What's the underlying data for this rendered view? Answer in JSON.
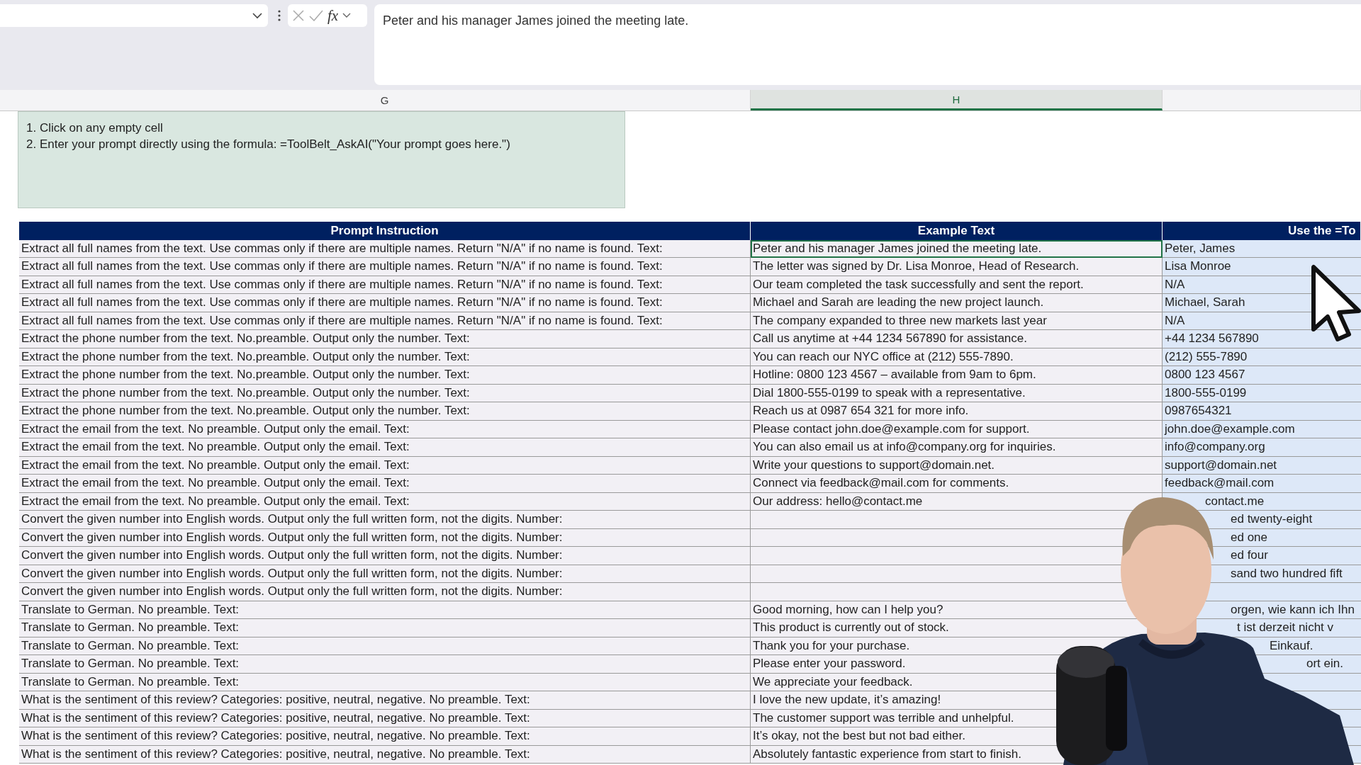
{
  "formula_bar": {
    "function_label": "fx",
    "content": "Peter and his manager James joined the meeting late."
  },
  "column_headers": [
    {
      "label": "G",
      "selected": false
    },
    {
      "label": "H",
      "selected": true
    }
  ],
  "instructions": [
    "1. Click on any empty cell",
    "2. Enter your prompt directly using the formula: =ToolBelt_AskAI(\"Your prompt goes here.\")"
  ],
  "table": {
    "columns": [
      "Prompt Instruction",
      "Example Text",
      "Use the =To"
    ],
    "rows": [
      {
        "prompt": "Extract all full names from the text. Use commas only if there are multiple names. Return \"N/A\" if no name is found. Text:",
        "example": "Peter and his manager James joined the meeting late.",
        "result": "Peter, James",
        "selected": true
      },
      {
        "prompt": "Extract all full names from the text. Use commas only if there are multiple names. Return \"N/A\" if no name is found. Text:",
        "example": "The letter was signed by Dr. Lisa Monroe, Head of Research.",
        "result": "Lisa Monroe",
        "selected": false
      },
      {
        "prompt": "Extract all full names from the text. Use commas only if there are multiple names. Return \"N/A\" if no name is found. Text:",
        "example": "Our team completed the task successfully and sent the report.",
        "result": "N/A",
        "selected": false
      },
      {
        "prompt": "Extract all full names from the text. Use commas only if there are multiple names. Return \"N/A\" if no name is found. Text:",
        "example": "Michael and Sarah are leading the new project launch.",
        "result": "Michael, Sarah",
        "selected": false
      },
      {
        "prompt": "Extract all full names from the text. Use commas only if there are multiple names. Return \"N/A\" if no name is found. Text:",
        "example": "The company expanded to three new markets last year",
        "result": "N/A",
        "selected": false
      },
      {
        "prompt": "Extract the phone number from the text. No.preamble. Output only the number. Text:",
        "example": "Call us anytime at +44 1234 567890 for assistance.",
        "result": "+44 1234 567890",
        "selected": false
      },
      {
        "prompt": "Extract the phone number from the text. No.preamble. Output only the number. Text:",
        "example": "You can reach our NYC office at (212) 555-7890.",
        "result": "(212) 555-7890",
        "selected": false
      },
      {
        "prompt": "Extract the phone number from the text. No.preamble. Output only the number. Text:",
        "example": "Hotline: 0800 123 4567 – available from 9am to 6pm.",
        "result": "0800 123 4567",
        "selected": false
      },
      {
        "prompt": "Extract the phone number from the text. No.preamble. Output only the number. Text:",
        "example": "Dial 1800-555-0199 to speak with a representative.",
        "result": "1800-555-0199",
        "selected": false
      },
      {
        "prompt": "Extract the phone number from the text. No.preamble. Output only the number. Text:",
        "example": "Reach us at 0987 654 321 for more info.",
        "result": "0987654321",
        "selected": false
      },
      {
        "prompt": "Extract the email from the text. No preamble. Output only the email. Text:",
        "example": "Please contact john.doe@example.com for support.",
        "result": "john.doe@example.com",
        "selected": false
      },
      {
        "prompt": "Extract the email from the text. No preamble. Output only the email. Text:",
        "example": "You can also email us at info@company.org for inquiries.",
        "result": "info@company.org",
        "selected": false
      },
      {
        "prompt": "Extract the email from the text. No preamble. Output only the email. Text:",
        "example": "Write your questions to support@domain.net.",
        "result": "support@domain.net",
        "selected": false
      },
      {
        "prompt": "Extract the email from the text. No preamble. Output only the email. Text:",
        "example": "Connect via feedback@mail.com for comments.",
        "result": "feedback@mail.com",
        "selected": false
      },
      {
        "prompt": "Extract the email from the text. No preamble. Output only the email. Text:",
        "example": "Our address: hello@contact.me",
        "result": "contact.me",
        "selected": false
      },
      {
        "prompt": "Convert the given number into English words. Output only the full written form, not the digits. Number:",
        "result": "ed twenty-eight",
        "selected": false
      },
      {
        "prompt": "Convert the given number into English words. Output only the full written form, not the digits. Number:",
        "result": "ed one",
        "selected": false
      },
      {
        "prompt": "Convert the given number into English words. Output only the full written form, not the digits. Number:",
        "result": "ed four",
        "selected": false
      },
      {
        "prompt": "Convert the given number into English words. Output only the full written form, not the digits. Number:",
        "result": "sand two hundred fift",
        "selected": false
      },
      {
        "prompt": "Convert the given number into English words. Output only the full written form, not the digits. Number:",
        "selected": false
      },
      {
        "prompt": "Translate to German. No preamble. Text:",
        "example": "Good morning, how can I help you?",
        "result": "orgen, wie kann ich Ihn",
        "selected": false
      },
      {
        "prompt": "Translate to German. No preamble. Text:",
        "example": "This product is currently out of stock.",
        "result": "t ist derzeit nicht v",
        "selected": false
      },
      {
        "prompt": "Translate to German. No preamble. Text:",
        "example": "Thank you for your purchase.",
        "result": "Einkauf.",
        "selected": false
      },
      {
        "prompt": "Translate to German. No preamble. Text:",
        "example": "Please enter your password.",
        "result": "ort ein.",
        "selected": false
      },
      {
        "prompt": "Translate to German. No preamble. Text:",
        "example": "We appreciate your feedback.",
        "selected": false
      },
      {
        "prompt": "What is the sentiment of this review? Categories: positive, neutral, negative. No preamble. Text:",
        "example": "I love the new update, it’s amazing!",
        "selected": false
      },
      {
        "prompt": "What is the sentiment of this review? Categories: positive, neutral, negative. No preamble. Text:",
        "example": "The customer support was terrible and unhelpful.",
        "selected": false
      },
      {
        "prompt": "What is the sentiment of this review? Categories: positive, neutral, negative. No preamble. Text:",
        "example": "It’s okay, not the best but not bad either.",
        "selected": false
      },
      {
        "prompt": "What is the sentiment of this review? Categories: positive, neutral, negative. No preamble. Text:",
        "example": "Absolutely fantastic experience from start to finish.",
        "selected": false
      }
    ]
  }
}
